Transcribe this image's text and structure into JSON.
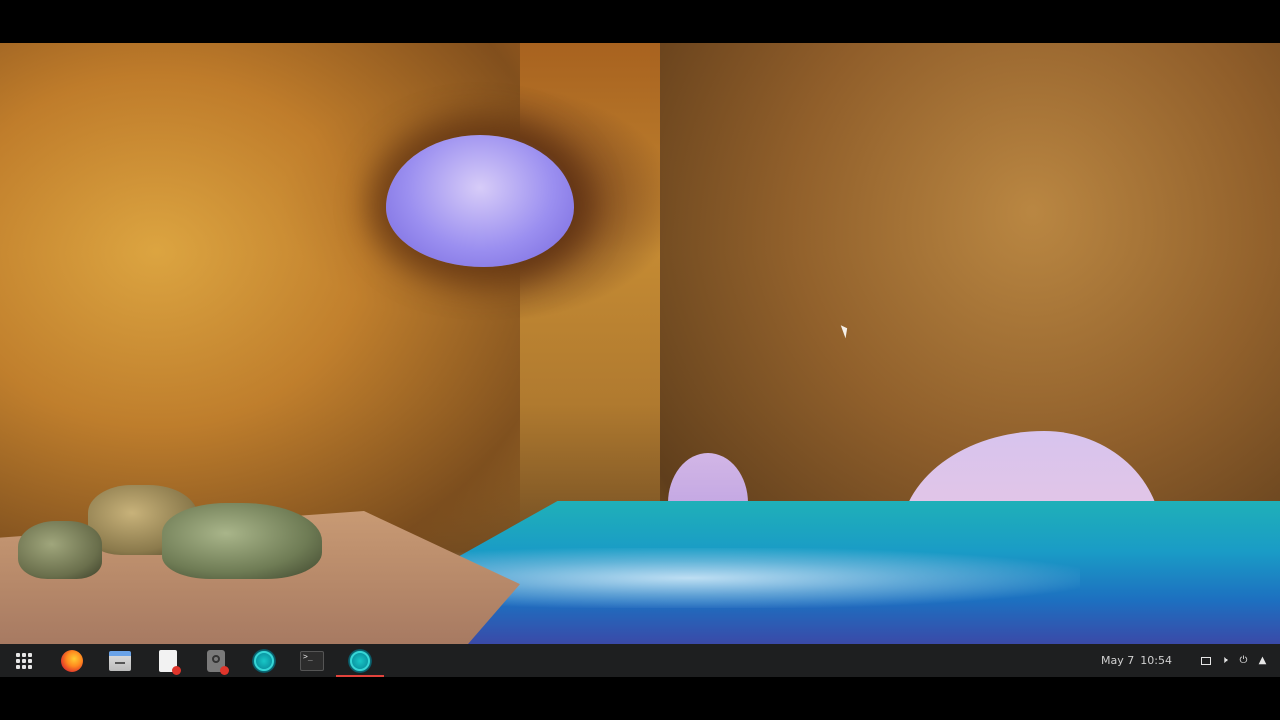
{
  "desktop": {
    "wallpaper": "sea-cave-beach",
    "cursor_visible": true
  },
  "taskbar": {
    "apps": [
      {
        "name": "apps-menu",
        "icon": "apps-grid-icon",
        "active": false
      },
      {
        "name": "firefox",
        "icon": "firefox-icon",
        "active": false
      },
      {
        "name": "files",
        "icon": "files-icon",
        "active": false
      },
      {
        "name": "text-editor",
        "icon": "text-editor-icon",
        "active": false
      },
      {
        "name": "passwords-keys",
        "icon": "keyring-icon",
        "active": false
      },
      {
        "name": "atom-1",
        "icon": "atom-icon",
        "active": false
      },
      {
        "name": "terminal",
        "icon": "terminal-icon",
        "active": false
      },
      {
        "name": "atom-2",
        "icon": "atom-icon",
        "active": true
      }
    ],
    "active_indicator_color": "#e3433c",
    "date": "May 7",
    "time": "10:54",
    "tray": [
      "screen-icon",
      "volume-icon",
      "power-icon",
      "arrow-up-icon"
    ]
  }
}
